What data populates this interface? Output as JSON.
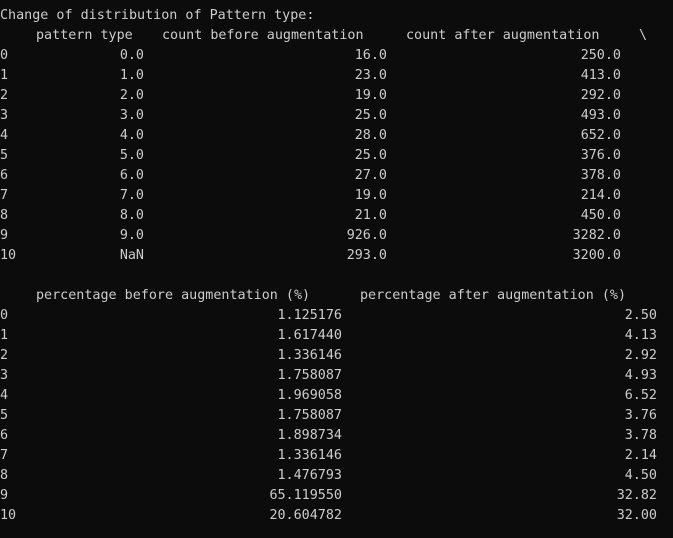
{
  "title": "Change of distribution of Pattern type:",
  "table1": {
    "headers": {
      "pattern_type": "pattern type",
      "count_before": "count before augmentation",
      "count_after": "count after augmentation",
      "continuation": "\\"
    },
    "rows": [
      {
        "index": "0",
        "pattern_type": "0.0",
        "count_before": "16.0",
        "count_after": "250.0"
      },
      {
        "index": "1",
        "pattern_type": "1.0",
        "count_before": "23.0",
        "count_after": "413.0"
      },
      {
        "index": "2",
        "pattern_type": "2.0",
        "count_before": "19.0",
        "count_after": "292.0"
      },
      {
        "index": "3",
        "pattern_type": "3.0",
        "count_before": "25.0",
        "count_after": "493.0"
      },
      {
        "index": "4",
        "pattern_type": "4.0",
        "count_before": "28.0",
        "count_after": "652.0"
      },
      {
        "index": "5",
        "pattern_type": "5.0",
        "count_before": "25.0",
        "count_after": "376.0"
      },
      {
        "index": "6",
        "pattern_type": "6.0",
        "count_before": "27.0",
        "count_after": "378.0"
      },
      {
        "index": "7",
        "pattern_type": "7.0",
        "count_before": "19.0",
        "count_after": "214.0"
      },
      {
        "index": "8",
        "pattern_type": "8.0",
        "count_before": "21.0",
        "count_after": "450.0"
      },
      {
        "index": "9",
        "pattern_type": "9.0",
        "count_before": "926.0",
        "count_after": "3282.0"
      },
      {
        "index": "10",
        "pattern_type": "NaN",
        "count_before": "293.0",
        "count_after": "3200.0"
      }
    ]
  },
  "table2": {
    "headers": {
      "pct_before": "percentage before augmentation (%)",
      "pct_after": "percentage after augmentation (%)"
    },
    "rows": [
      {
        "index": "0",
        "pct_before": "1.125176",
        "pct_after": "2.50"
      },
      {
        "index": "1",
        "pct_before": "1.617440",
        "pct_after": "4.13"
      },
      {
        "index": "2",
        "pct_before": "1.336146",
        "pct_after": "2.92"
      },
      {
        "index": "3",
        "pct_before": "1.758087",
        "pct_after": "4.93"
      },
      {
        "index": "4",
        "pct_before": "1.969058",
        "pct_after": "6.52"
      },
      {
        "index": "5",
        "pct_before": "1.758087",
        "pct_after": "3.76"
      },
      {
        "index": "6",
        "pct_before": "1.898734",
        "pct_after": "3.78"
      },
      {
        "index": "7",
        "pct_before": "1.336146",
        "pct_after": "2.14"
      },
      {
        "index": "8",
        "pct_before": "1.476793",
        "pct_after": "4.50"
      },
      {
        "index": "9",
        "pct_before": "65.119550",
        "pct_after": "32.82"
      },
      {
        "index": "10",
        "pct_before": "20.604782",
        "pct_after": "32.00"
      }
    ]
  }
}
